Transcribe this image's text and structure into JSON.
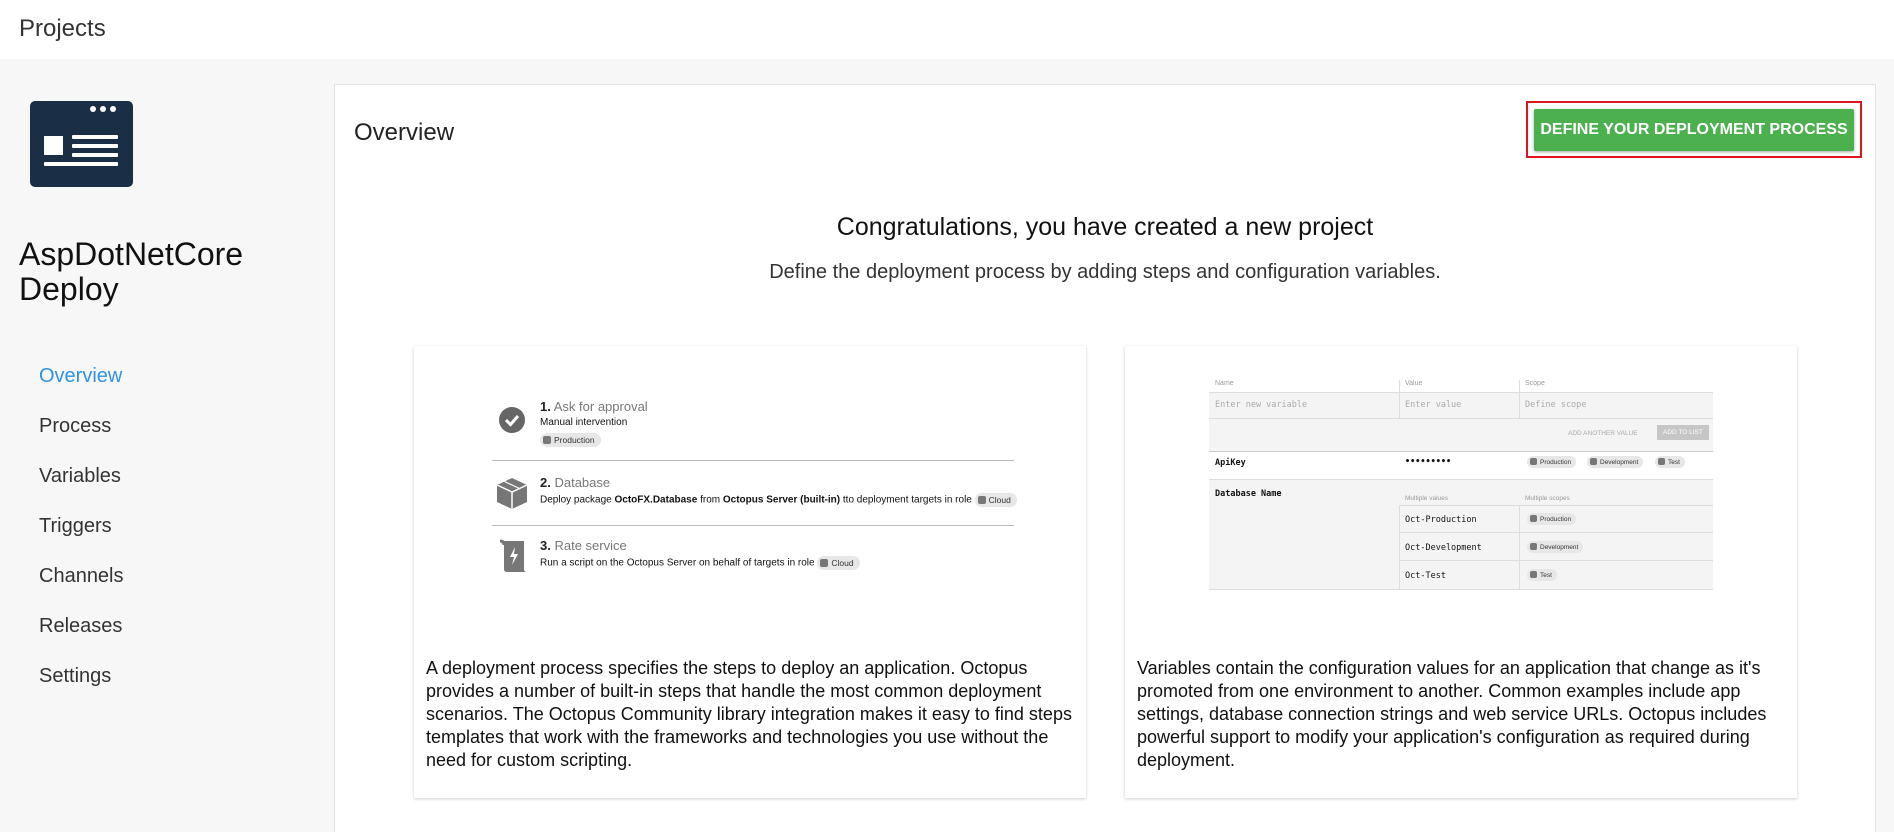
{
  "topbar": {
    "title": "Projects"
  },
  "sidebar": {
    "project_name": "AspDotNetCore Deploy",
    "nav": [
      {
        "label": "Overview",
        "active": true
      },
      {
        "label": "Process"
      },
      {
        "label": "Variables"
      },
      {
        "label": "Triggers"
      },
      {
        "label": "Channels"
      },
      {
        "label": "Releases"
      },
      {
        "label": "Settings"
      }
    ]
  },
  "main": {
    "title": "Overview",
    "cta_label": "DEFINE YOUR DEPLOYMENT PROCESS",
    "heading": "Congratulations, you have created a new project",
    "subheading": "Define the deployment process by adding steps and configuration variables."
  },
  "process_card": {
    "steps": [
      {
        "number": "1.",
        "title": "Ask for approval",
        "desc": "Manual intervention",
        "chip": "Production"
      },
      {
        "number": "2.",
        "title": "Database",
        "desc_pre": "Deploy package ",
        "desc_pkg": "OctoFX.Database",
        "desc_mid": " from ",
        "desc_feed": "Octopus Server (built-in)",
        "desc_post": " tto deployment targets in role",
        "chip": "Cloud"
      },
      {
        "number": "3.",
        "title": "Rate service",
        "desc": "Run a script on the Octopus Server on behalf of targets in role",
        "chip": "Cloud"
      }
    ],
    "description": "A deployment process specifies the steps to deploy an application. Octopus provides a number of built-in steps that handle the most common deployment scenarios. The Octopus Community library integration makes it easy to find steps templates that work with the frameworks and technologies you use without the need for custom scripting."
  },
  "variables_card": {
    "headers": {
      "name": "Name",
      "value": "Value",
      "scope": "Scope"
    },
    "placeholders": {
      "name": "Enter new variable",
      "value": "Enter value",
      "scope": "Define scope"
    },
    "add_another": "ADD ANOTHER VALUE",
    "add_to_list": "ADD TO LIST",
    "api_key": {
      "name": "ApiKey",
      "value": "•••••••••",
      "scopes": [
        "Production",
        "Development",
        "Test"
      ]
    },
    "db_name": {
      "name": "Database Name",
      "multiple_values": "Multiple values",
      "multiple_scopes": "Multiple scopes",
      "rows": [
        {
          "value": "Oct-Production",
          "scope": "Production"
        },
        {
          "value": "Oct-Development",
          "scope": "Development"
        },
        {
          "value": "Oct-Test",
          "scope": "Test"
        }
      ]
    },
    "description": "Variables contain the configuration values for an application that change as it's promoted from one environment to another. Common examples include app settings, database connection strings and web service URLs. Octopus includes powerful support to modify your application's configuration as required during deployment."
  },
  "colors": {
    "accent": "#2f93e0",
    "cta": "#4cb04f",
    "highlight": "#e0141e",
    "logo": "#1a2f45"
  },
  "icons": [
    "browser-window-icon",
    "check-circle-icon",
    "package-box-icon",
    "script-icon",
    "tag-icon",
    "environment-icon"
  ]
}
